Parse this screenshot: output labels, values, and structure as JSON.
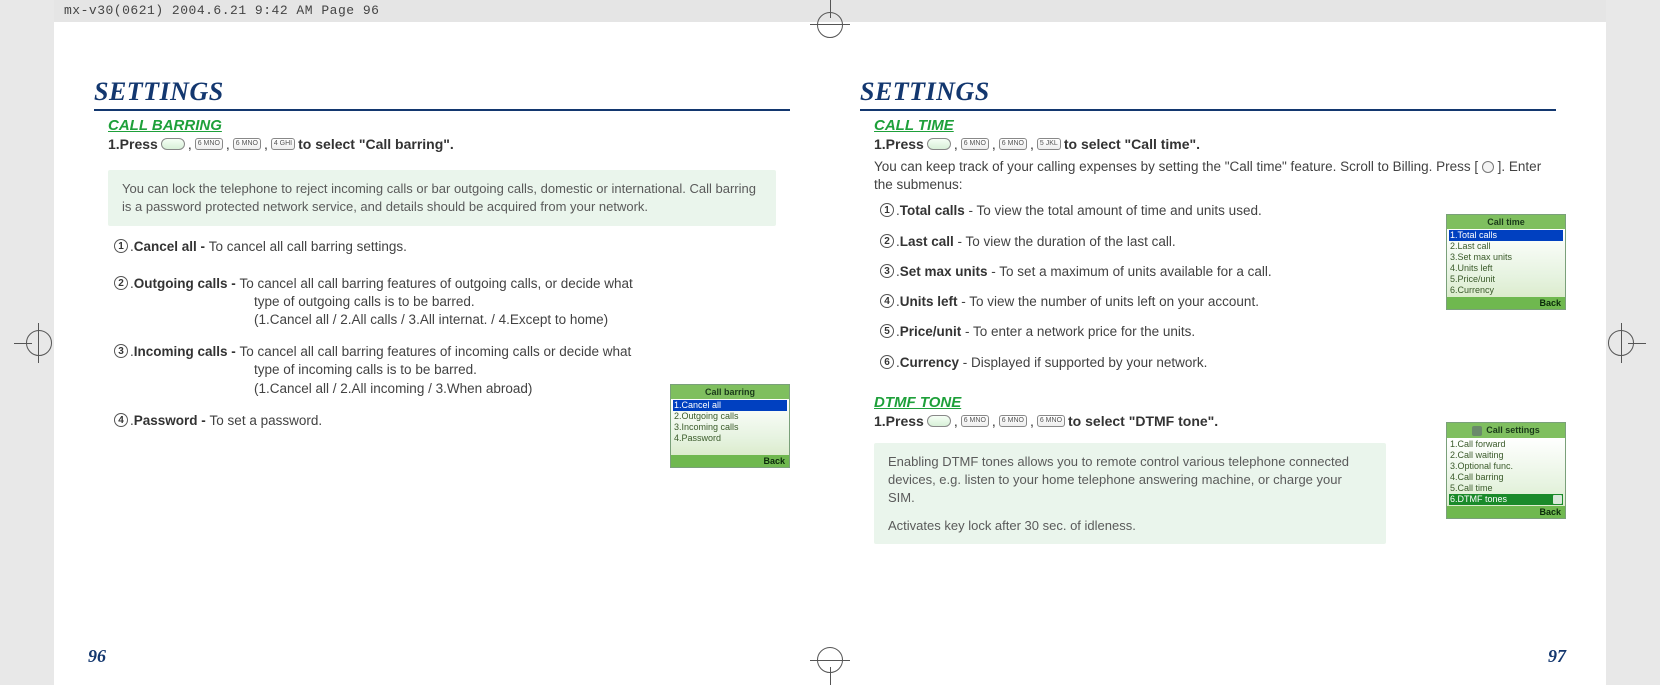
{
  "header": "mx-v30(0621)  2004.6.21  9:42 AM  Page 96",
  "left": {
    "title": "SETTINGS",
    "sub1": "CALL BARRING",
    "press_prefix": "1.Press",
    "keys": [
      "",
      "6 MNO",
      "6 MNO",
      "4 GHI"
    ],
    "press_suffix": "to select \"Call barring\".",
    "note": "You can lock the telephone to reject incoming calls or bar outgoing calls, domestic or international. Call barring is a password protected network service, and details should be acquired from your network.",
    "items": [
      {
        "n": "1",
        "label": "Cancel all - ",
        "desc": "To cancel all call barring settings."
      },
      {
        "n": "2",
        "label": "Outgoing calls - ",
        "desc": "To cancel all call barring features of outgoing calls, or decide what",
        "sub1": "type of outgoing calls is to be barred.",
        "sub2": "(1.Cancel all / 2.All calls /  3.All internat. / 4.Except to home)"
      },
      {
        "n": "3",
        "label": "Incoming calls - ",
        "desc": "To cancel all call barring features of incoming calls or  decide what",
        "sub1": "type of incoming calls is to be barred.",
        "sub2": "(1.Cancel all / 2.All incoming /  3.When abroad)"
      },
      {
        "n": "4",
        "label": "Password - ",
        "desc": "To set a password."
      }
    ],
    "screen": {
      "title": "Call barring",
      "rows": [
        "1.Cancel all",
        "2.Outgoing calls",
        "3.Incoming calls",
        "4.Password"
      ],
      "selected": 0,
      "footer": "Back"
    },
    "pagenum": "96"
  },
  "right": {
    "title": "SETTINGS",
    "sub1": "CALL TIME",
    "press1_prefix": "1.Press",
    "keys1": [
      "",
      "6 MNO",
      "6 MNO",
      "5 JKL"
    ],
    "press1_suffix": "to select \"Call time\".",
    "intro1": "You can keep track of your calling expenses by setting the \"Call time\" feature. Scroll to Billing. Press [",
    "intro2": "]. Enter the submenus:",
    "items": [
      {
        "n": "1",
        "label": "Total calls",
        "desc": " - To view the total amount of  time and units used."
      },
      {
        "n": "2",
        "label": "Last call",
        "desc": " - To view the duration of the last call."
      },
      {
        "n": "3",
        "label": "Set max units",
        "desc": " - To set a maximum of units available for a call."
      },
      {
        "n": "4",
        "label": "Units left",
        "desc": " - To view the number of units left on your account."
      },
      {
        "n": "5",
        "label": "Price/unit",
        "desc": " - To enter a network price for the units."
      },
      {
        "n": "6",
        "label": "Currency",
        "desc": " - Displayed if supported by your network."
      }
    ],
    "screen1": {
      "title": "Call time",
      "rows": [
        "1.Total calls",
        "2.Last call",
        "3.Set max units",
        "4.Units left",
        "5.Price/unit",
        "6.Currency"
      ],
      "selected": 0,
      "footer": "Back"
    },
    "sub2": "DTMF TONE",
    "press2_prefix": "1.Press",
    "keys2": [
      "",
      "6 MNO",
      "6 MNO",
      "6 MNO"
    ],
    "press2_suffix": "to select \"DTMF tone\".",
    "note2a": "Enabling DTMF tones allows you to remote control various telephone connected devices, e.g. listen to your home telephone answering machine, or charge your SIM.",
    "note2b": "Activates key lock after 30 sec. of idleness.",
    "screen2": {
      "title": "Call settings",
      "rows": [
        "1.Call forward",
        "2.Call waiting",
        "3.Optional func.",
        "4.Call barring",
        "5.Call time",
        "6.DTMF tones"
      ],
      "selected": 5,
      "footer": "Back"
    },
    "pagenum": "97"
  }
}
